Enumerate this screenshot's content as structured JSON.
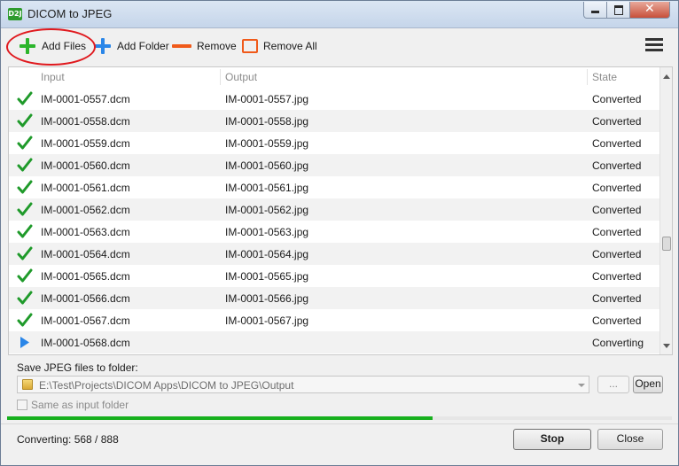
{
  "window": {
    "title": "DICOM to JPEG",
    "icon": "D2J"
  },
  "toolbar": {
    "add_files": "Add Files",
    "add_folder": "Add Folder",
    "remove": "Remove",
    "remove_all": "Remove All",
    "colors": {
      "add_files": "#2bb52b",
      "add_folder": "#2a86e8",
      "remove": "#f05a1a"
    }
  },
  "table": {
    "headers": {
      "input": "Input",
      "output": "Output",
      "state": "State"
    },
    "rows": [
      {
        "status_icon": "check-icon",
        "input": "IM-0001-0557.dcm",
        "output": "IM-0001-0557.jpg",
        "state": "Converted"
      },
      {
        "status_icon": "check-icon",
        "input": "IM-0001-0558.dcm",
        "output": "IM-0001-0558.jpg",
        "state": "Converted"
      },
      {
        "status_icon": "check-icon",
        "input": "IM-0001-0559.dcm",
        "output": "IM-0001-0559.jpg",
        "state": "Converted"
      },
      {
        "status_icon": "check-icon",
        "input": "IM-0001-0560.dcm",
        "output": "IM-0001-0560.jpg",
        "state": "Converted"
      },
      {
        "status_icon": "check-icon",
        "input": "IM-0001-0561.dcm",
        "output": "IM-0001-0561.jpg",
        "state": "Converted"
      },
      {
        "status_icon": "check-icon",
        "input": "IM-0001-0562.dcm",
        "output": "IM-0001-0562.jpg",
        "state": "Converted"
      },
      {
        "status_icon": "check-icon",
        "input": "IM-0001-0563.dcm",
        "output": "IM-0001-0563.jpg",
        "state": "Converted"
      },
      {
        "status_icon": "check-icon",
        "input": "IM-0001-0564.dcm",
        "output": "IM-0001-0564.jpg",
        "state": "Converted"
      },
      {
        "status_icon": "check-icon",
        "input": "IM-0001-0565.dcm",
        "output": "IM-0001-0565.jpg",
        "state": "Converted"
      },
      {
        "status_icon": "check-icon",
        "input": "IM-0001-0566.dcm",
        "output": "IM-0001-0566.jpg",
        "state": "Converted"
      },
      {
        "status_icon": "check-icon",
        "input": "IM-0001-0567.dcm",
        "output": "IM-0001-0567.jpg",
        "state": "Converted"
      },
      {
        "status_icon": "play-icon",
        "input": "IM-0001-0568.dcm",
        "output": "",
        "state": "Converting"
      }
    ]
  },
  "output": {
    "label": "Save JPEG files to folder:",
    "path": "E:\\Test\\Projects\\DICOM Apps\\DICOM to JPEG\\Output",
    "browse_label": "...",
    "open_label": "Open",
    "same_as_input_label": "Same as input folder",
    "same_as_input_checked": false
  },
  "progress": {
    "done": 568,
    "total": 888,
    "fraction": 0.64,
    "color": "#17b01e"
  },
  "status": {
    "text": "Converting: 568 / 888"
  },
  "buttons": {
    "stop": "Stop",
    "close": "Close"
  }
}
